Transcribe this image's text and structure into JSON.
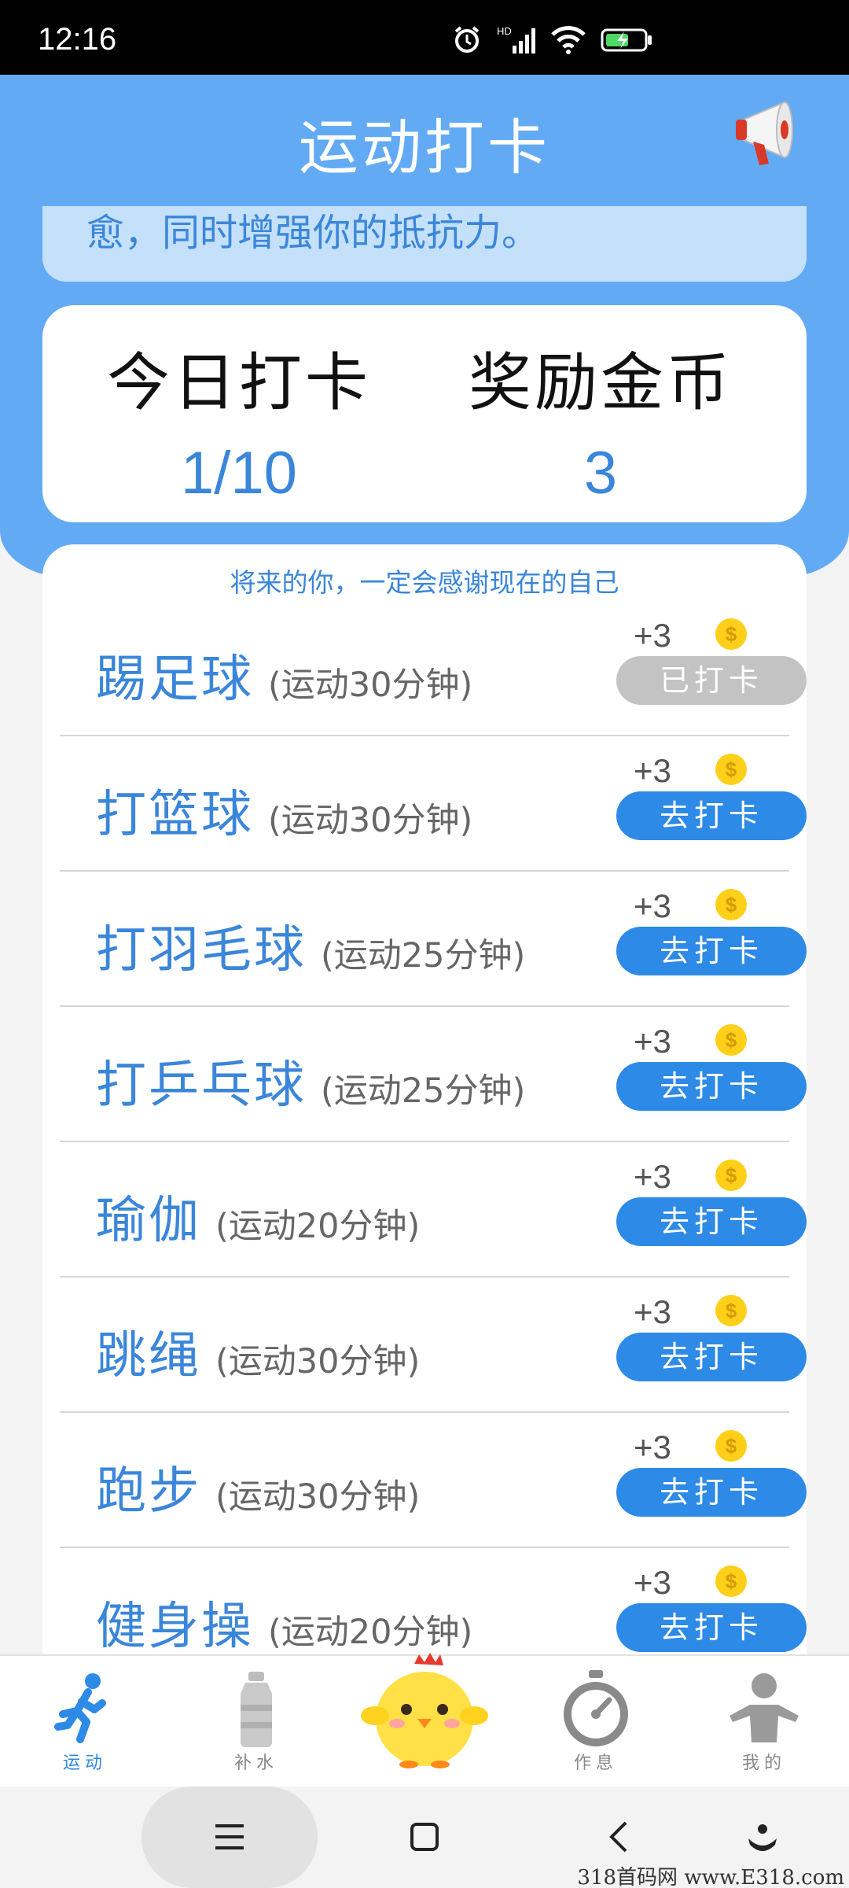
{
  "status_bar": {
    "time": "12:16"
  },
  "header": {
    "title": "运动打卡"
  },
  "tip": {
    "text": "愈，同时增强你的抵抗力。"
  },
  "stats": {
    "today_label": "今日打卡",
    "today_value": "1/10",
    "coins_label": "奖励金币",
    "coins_value": "3"
  },
  "motto": "将来的你，一定会感谢现在的自己",
  "activities": [
    {
      "name": "踢足球",
      "duration": "(运动30分钟)",
      "reward": "+3",
      "button": "已打卡",
      "done": true
    },
    {
      "name": "打篮球",
      "duration": "(运动30分钟)",
      "reward": "+3",
      "button": "去打卡",
      "done": false
    },
    {
      "name": "打羽毛球",
      "duration": "(运动25分钟)",
      "reward": "+3",
      "button": "去打卡",
      "done": false
    },
    {
      "name": "打乒乓球",
      "duration": "(运动25分钟)",
      "reward": "+3",
      "button": "去打卡",
      "done": false
    },
    {
      "name": "瑜伽",
      "duration": "(运动20分钟)",
      "reward": "+3",
      "button": "去打卡",
      "done": false
    },
    {
      "name": "跳绳",
      "duration": "(运动30分钟)",
      "reward": "+3",
      "button": "去打卡",
      "done": false
    },
    {
      "name": "跑步",
      "duration": "(运动30分钟)",
      "reward": "+3",
      "button": "去打卡",
      "done": false
    },
    {
      "name": "健身操",
      "duration": "(运动20分钟)",
      "reward": "+3",
      "button": "去打卡",
      "done": false
    }
  ],
  "tabs": {
    "sport": "运动",
    "water": "补水",
    "rest": "作息",
    "me": "我的"
  },
  "watermark": "318首码网 www.E318.com",
  "colors": {
    "primary": "#62abf4",
    "accent": "#2d8ae6",
    "text_blue": "#3a86da",
    "coin": "#ffcf1a"
  }
}
